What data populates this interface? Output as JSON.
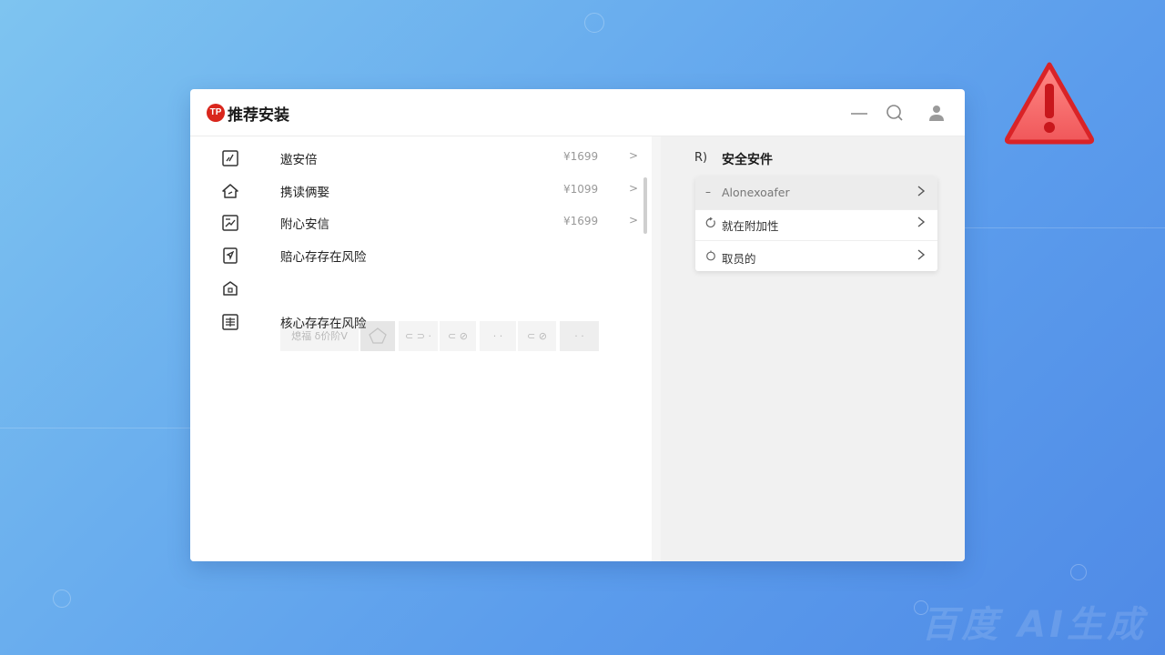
{
  "window": {
    "title": "推荐安装",
    "logo_text": "TP",
    "brand_color": "#d9261c"
  },
  "titlebar_icons": [
    "minimize-icon",
    "search-icon",
    "user-icon"
  ],
  "list": {
    "items": [
      {
        "label": "遨安倍",
        "price": "¥1699",
        "arrow": ">",
        "icon": "checkbox-edit-icon"
      },
      {
        "label": "携读俩娶",
        "price": "¥1099",
        "arrow": ">",
        "icon": "home-icon"
      },
      {
        "label": "附心安信",
        "price": "¥1699",
        "arrow": ">",
        "icon": "image-icon"
      },
      {
        "label": "赔心存存在风险",
        "icon": "send-icon"
      },
      {
        "label": "",
        "icon": "home-lock-icon"
      },
      {
        "label": "核心存存在风险",
        "icon": "list-icon"
      }
    ],
    "toolstrip": [
      "熄福  δ价阶V",
      "",
      "⊂ ⊃ ·",
      "⊂ ⊘",
      "· ·",
      "⊂ ⊘",
      "· ·"
    ]
  },
  "right_panel": {
    "header_icon": "R)",
    "header": "安全安件",
    "card_items": [
      {
        "label": "Alonexoafer",
        "icon": "dash-icon",
        "selected": true
      },
      {
        "label": "就在附加性",
        "icon": "refresh-icon",
        "selected": false
      },
      {
        "label": "取员的",
        "icon": "circle-icon",
        "selected": false
      }
    ]
  },
  "watermark": "百度 AI生成",
  "warning_color": "#e8272b"
}
